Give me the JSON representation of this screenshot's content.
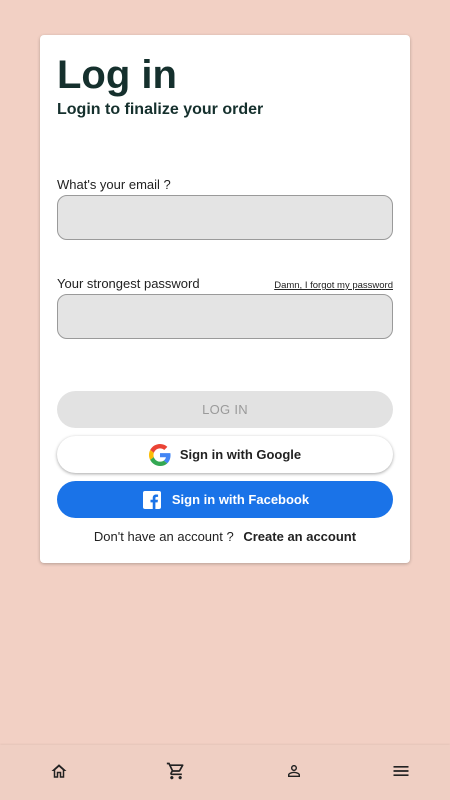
{
  "login": {
    "title": "Log in",
    "subtitle": "Login to finalize your order",
    "email_label": "What's your email ?",
    "email_value": "",
    "password_label": "Your strongest password",
    "password_value": "",
    "forgot_password": "Damn, I forgot my password",
    "login_button": "LOG IN",
    "google_button": "Sign in with Google",
    "facebook_button": "Sign in with Facebook",
    "no_account_text": "Don't have an account ?",
    "create_account_link": "Create an account"
  },
  "bottom_nav": {
    "items": [
      {
        "icon": "home-icon"
      },
      {
        "icon": "cart-icon"
      },
      {
        "icon": "account-icon"
      },
      {
        "icon": "menu-icon"
      }
    ]
  },
  "colors": {
    "background": "#f2d0c4",
    "title": "#15302d",
    "facebook_blue": "#1a73e8",
    "disabled_button": "#e2e2e2"
  }
}
